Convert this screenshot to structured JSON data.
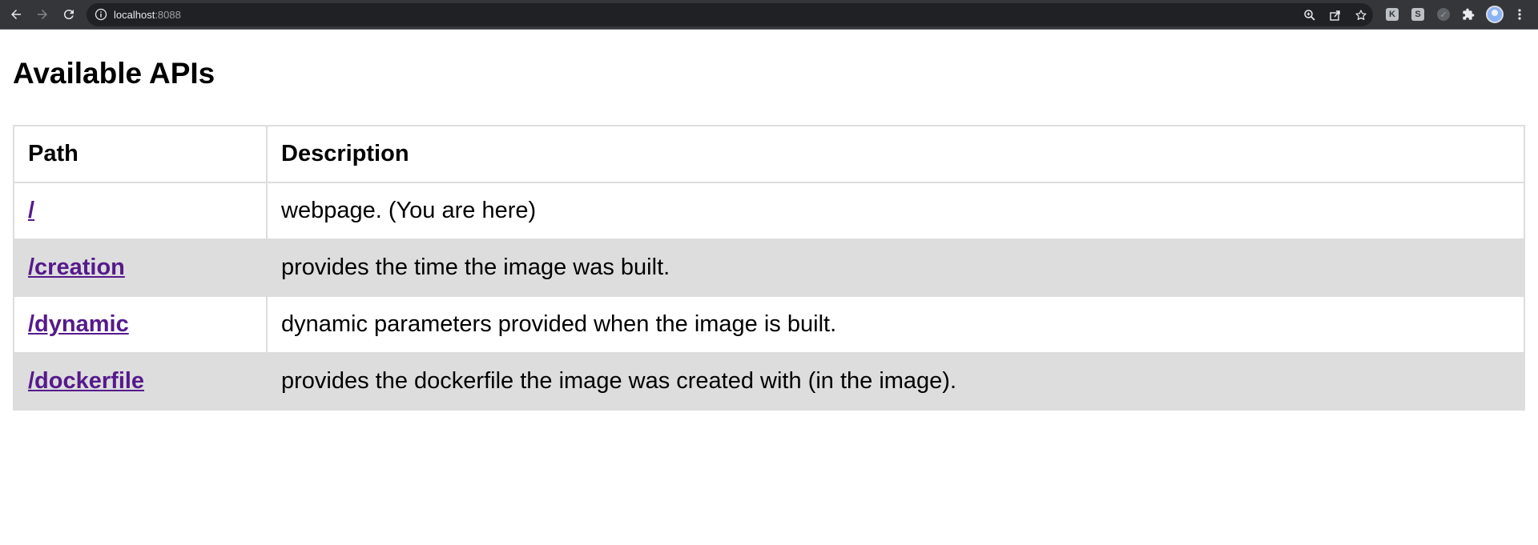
{
  "browser": {
    "url_host": "localhost",
    "url_port": ":8088",
    "icons": {
      "back": "arrow-left-icon",
      "forward": "arrow-right-icon",
      "reload": "reload-icon",
      "site_info": "info-icon",
      "zoom": "zoom-icon",
      "share": "share-icon",
      "bookmark": "star-icon",
      "extensions": "puzzle-icon",
      "menu": "kebab-menu-icon"
    },
    "extensions": [
      {
        "name": "extension-k",
        "glyph": "K"
      },
      {
        "name": "extension-s",
        "glyph": "S"
      },
      {
        "name": "extension-check",
        "glyph": "✓"
      }
    ]
  },
  "page": {
    "title": "Available APIs",
    "table": {
      "headers": {
        "path": "Path",
        "description": "Description"
      },
      "rows": [
        {
          "path": "/",
          "description": "webpage. (You are here)"
        },
        {
          "path": "/creation",
          "description": "provides the time the image was built."
        },
        {
          "path": "/dynamic",
          "description": "dynamic parameters provided when the image is built."
        },
        {
          "path": "/dockerfile",
          "description": "provides the dockerfile the image was created with (in the image)."
        }
      ]
    }
  },
  "colors": {
    "chrome_bg": "#35363a",
    "omnibox_bg": "#202124",
    "stripe_bg": "#dddddd",
    "visited_link": "#551a8b"
  }
}
